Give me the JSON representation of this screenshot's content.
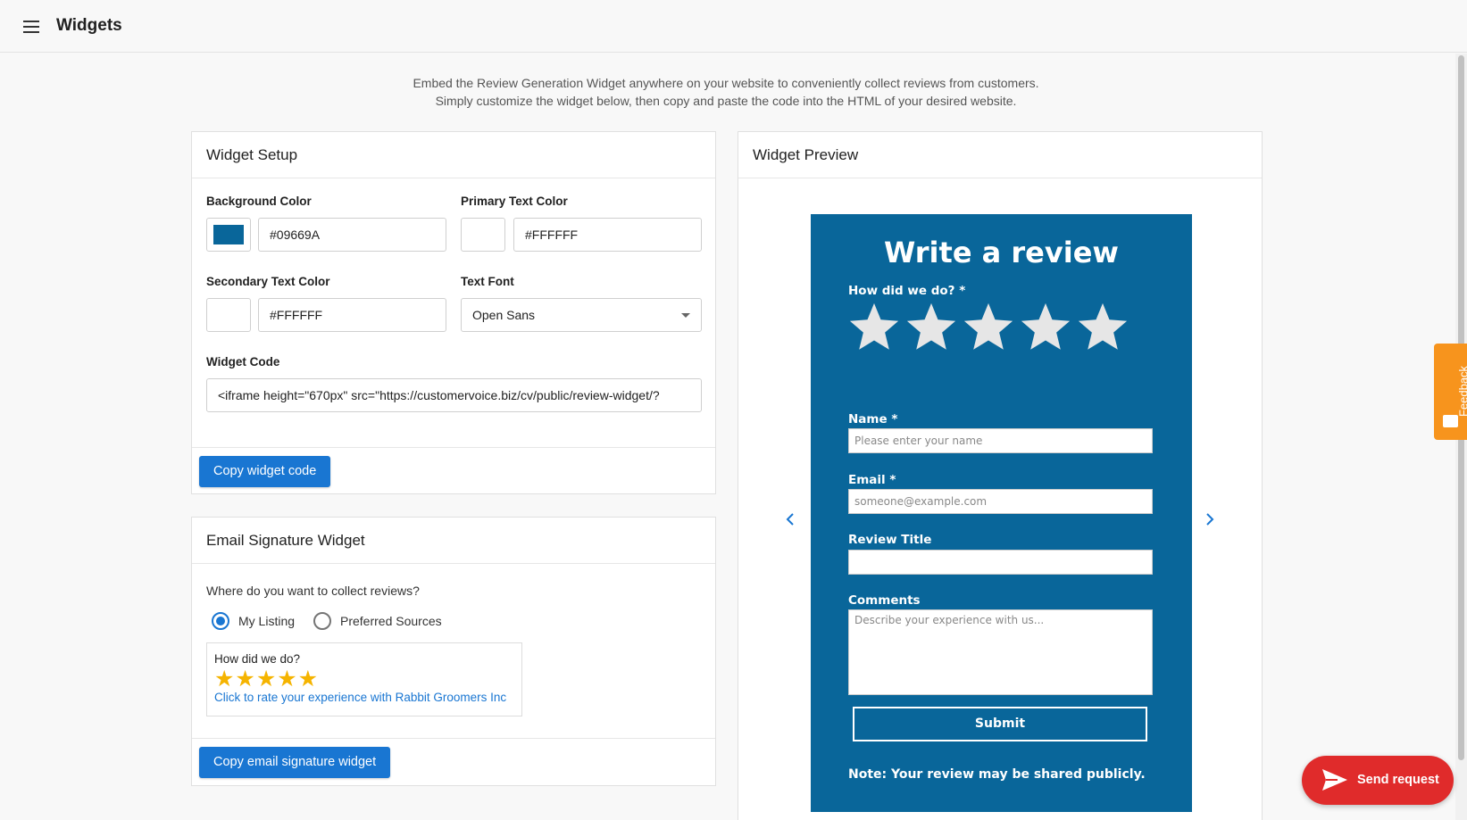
{
  "header": {
    "title": "Widgets",
    "menu_icon": "menu-icon"
  },
  "intro": {
    "line1": "Embed the Review Generation Widget anywhere on your website to conveniently collect reviews from customers.",
    "line2": "Simply customize the widget below, then copy and paste the code into the HTML of your desired website."
  },
  "setup": {
    "title": "Widget Setup",
    "background_color": {
      "label": "Background Color",
      "value": "#09669A"
    },
    "primary_text_color": {
      "label": "Primary Text Color",
      "value": "#FFFFFF"
    },
    "secondary_text_color": {
      "label": "Secondary Text Color",
      "value": "#FFFFFF"
    },
    "text_font": {
      "label": "Text Font",
      "value": "Open Sans"
    },
    "widget_code": {
      "label": "Widget Code",
      "value": "<iframe height=\"670px\" src=\"https://customervoice.biz/cv/public/review-widget/?"
    },
    "copy_button": "Copy widget code"
  },
  "email_signature": {
    "title": "Email Signature Widget",
    "question": "Where do you want to collect reviews?",
    "options": [
      {
        "label": "My Listing",
        "selected": true
      },
      {
        "label": "Preferred Sources",
        "selected": false
      }
    ],
    "preview": {
      "question": "How did we do?",
      "stars": "★★★★★",
      "link": "Click to rate your experience with Rabbit Groomers Inc"
    },
    "copy_button": "Copy email signature widget"
  },
  "preview": {
    "title": "Widget Preview",
    "widget": {
      "heading": "Write a review",
      "rating_label": "How did we do? *",
      "star_count": 5,
      "name_label": "Name *",
      "name_placeholder": "Please enter your name",
      "email_label": "Email *",
      "email_placeholder": "someone@example.com",
      "review_title_label": "Review Title",
      "review_title_placeholder": "",
      "comments_label": "Comments",
      "comments_placeholder": "Describe your experience with us...",
      "submit_label": "Submit",
      "note": "Note: Your review may be shared publicly."
    }
  },
  "feedback_tab": {
    "label": "Feedback"
  },
  "send_request": {
    "label": "Send request"
  },
  "colors": {
    "accent": "#1976d2",
    "widget_bg": "#09669A",
    "star_gold": "#f5b400",
    "feedback": "#f7941d",
    "send": "#e02b2b"
  }
}
